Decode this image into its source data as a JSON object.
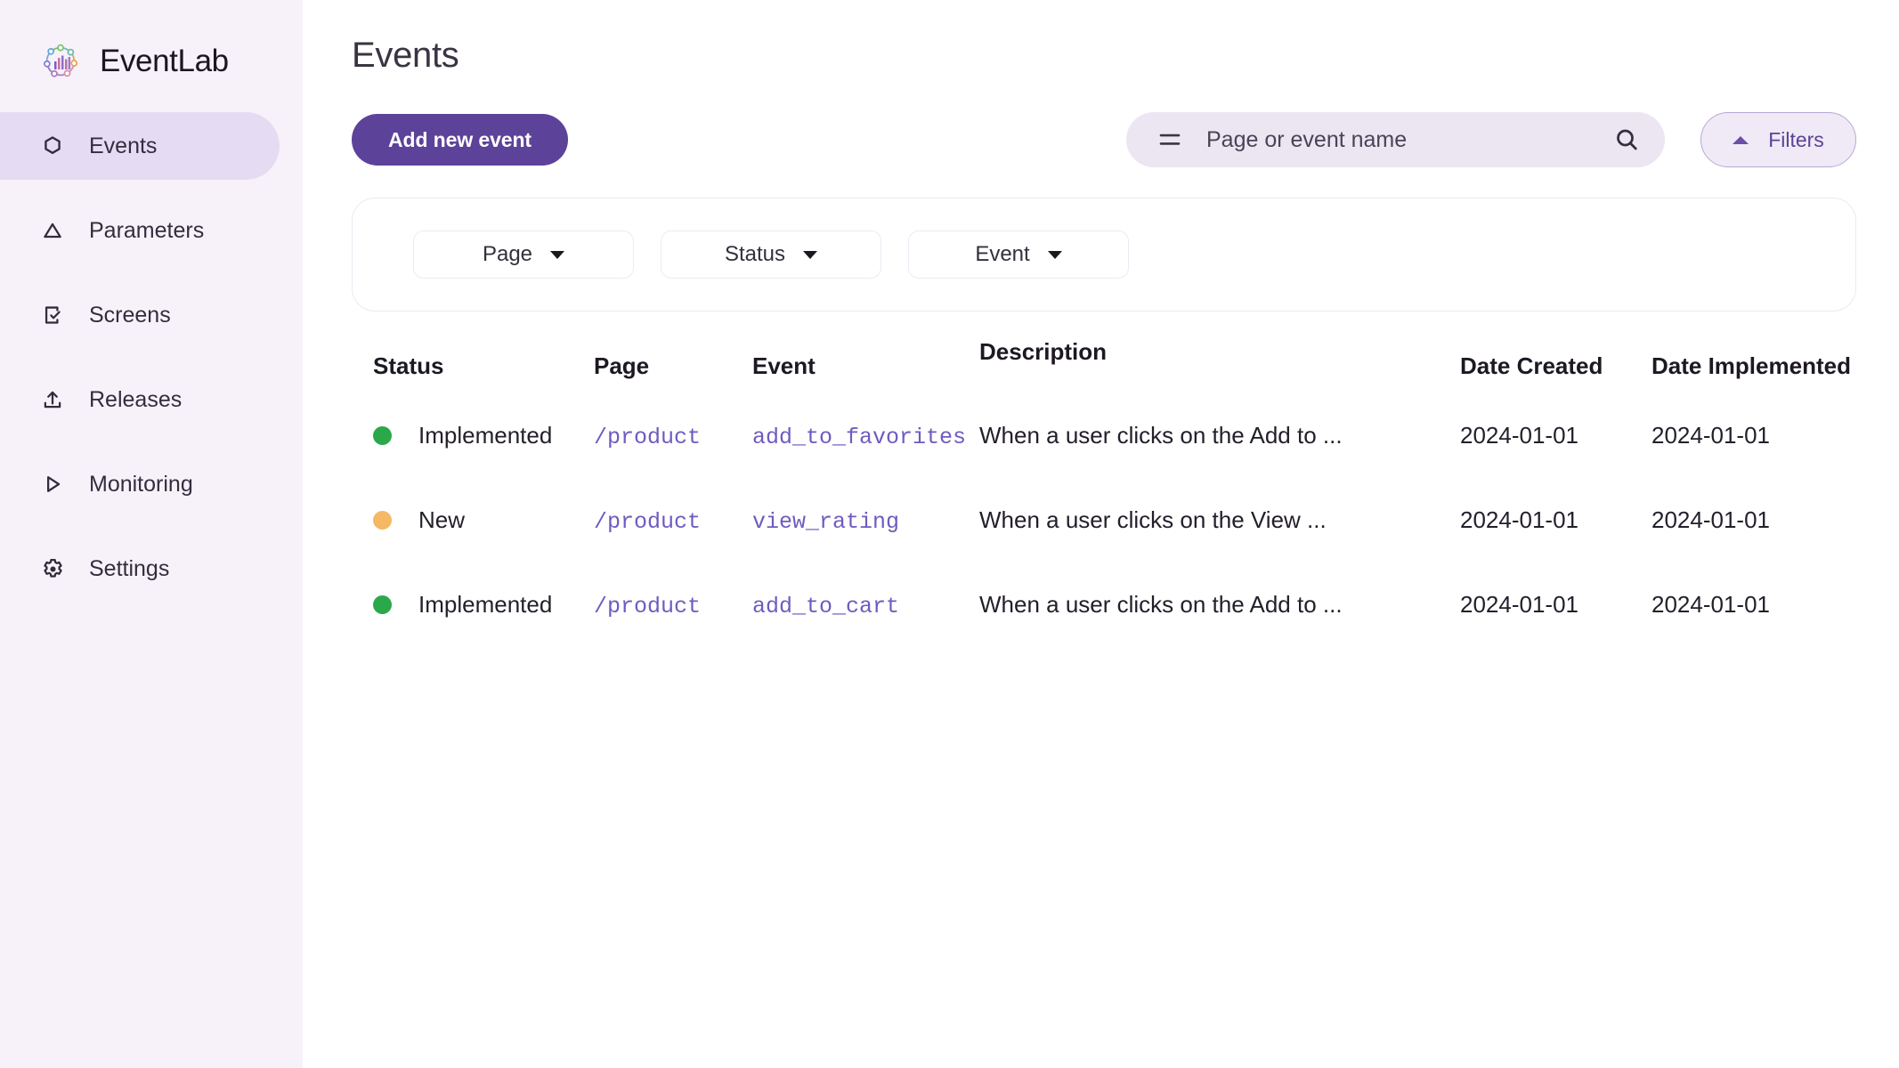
{
  "brand": {
    "name": "EventLab",
    "logo_icon": "eventlab-network-chart-logo"
  },
  "sidebar": {
    "items": [
      {
        "label": "Events",
        "icon": "hexagon-icon",
        "active": true
      },
      {
        "label": "Parameters",
        "icon": "triangle-icon",
        "active": false
      },
      {
        "label": "Screens",
        "icon": "mobile-check-icon",
        "active": false
      },
      {
        "label": "Releases",
        "icon": "upload-icon",
        "active": false
      },
      {
        "label": "Monitoring",
        "icon": "play-icon",
        "active": false
      },
      {
        "label": "Settings",
        "icon": "gear-icon",
        "active": false
      }
    ]
  },
  "header": {
    "title": "Events"
  },
  "toolbar": {
    "add_event_label": "Add new event",
    "search": {
      "placeholder": "Page or event name",
      "value": "",
      "menu_icon": "hamburger-icon",
      "search_icon": "search-icon"
    },
    "filters_label": "Filters",
    "filters_caret_icon": "caret-up-icon",
    "filters_expanded": true
  },
  "filter_panel": {
    "selects": [
      {
        "label": "Page",
        "caret_icon": "caret-down-icon"
      },
      {
        "label": "Status",
        "caret_icon": "caret-down-icon"
      },
      {
        "label": "Event",
        "caret_icon": "caret-down-icon"
      }
    ]
  },
  "table": {
    "columns": {
      "status": "Status",
      "page": "Page",
      "event": "Event",
      "description": "Description",
      "date_created": "Date Created",
      "date_implemented": "Date Implemented"
    },
    "rows": [
      {
        "status": "Implemented",
        "status_color": "#2ba84a",
        "page": "/product",
        "event": "add_to_favorites",
        "description": "When a user clicks on the Add to ...",
        "date_created": "2024-01-01",
        "date_implemented": "2024-01-01"
      },
      {
        "status": "New",
        "status_color": "#f5b865",
        "page": "/product",
        "event": "view_rating",
        "description": "When a user clicks on the View ...",
        "date_created": "2024-01-01",
        "date_implemented": "2024-01-01"
      },
      {
        "status": "Implemented",
        "status_color": "#2ba84a",
        "page": "/product",
        "event": "add_to_cart",
        "description": "When a user clicks on the Add to ...",
        "date_created": "2024-01-01",
        "date_implemented": "2024-01-01"
      }
    ]
  },
  "colors": {
    "accent_purple": "#5d4299",
    "sidebar_bg": "#f7f2fa",
    "active_item_bg": "#e5dcf3",
    "link_purple": "#6f5bc0",
    "status_implemented": "#2ba84a",
    "status_new": "#f5b865"
  }
}
